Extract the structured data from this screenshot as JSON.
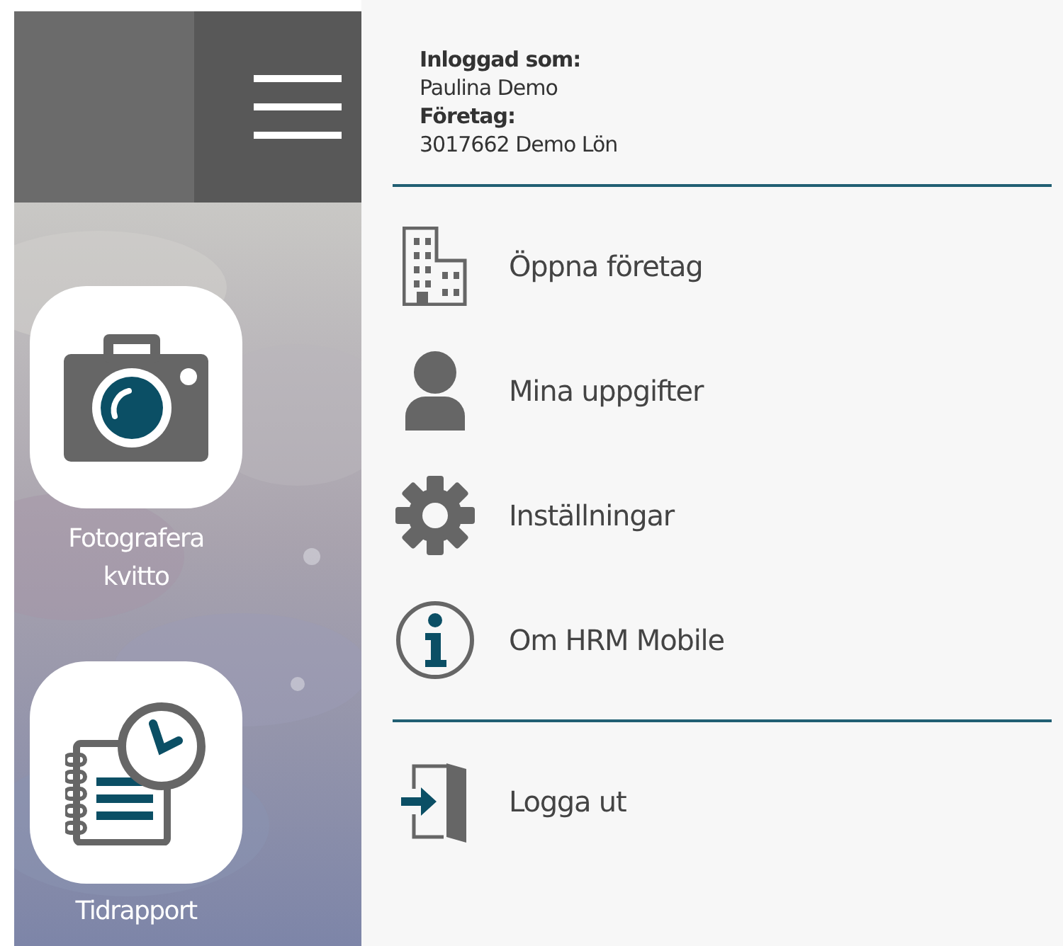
{
  "sidebar": {
    "tiles": [
      {
        "label": "Fotografera\nkvitto"
      },
      {
        "label": "Tidrapport"
      }
    ]
  },
  "account": {
    "user_label": "Inloggad som:",
    "user": "Paulina Demo",
    "company_label": "Företag:",
    "company": "3017662 Demo Lön"
  },
  "menu": [
    {
      "label": "Öppna företag"
    },
    {
      "label": "Mina uppgifter"
    },
    {
      "label": "Inställningar"
    },
    {
      "label": "Om HRM Mobile"
    }
  ],
  "footer_menu": [
    {
      "label": "Logga ut"
    }
  ]
}
